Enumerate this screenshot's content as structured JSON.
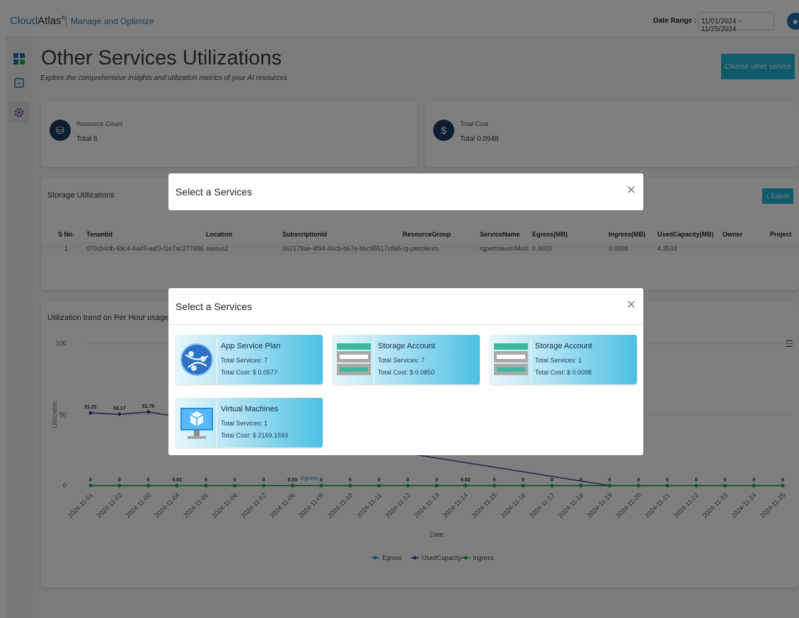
{
  "app": {
    "brand_name": "Cloud",
    "brand_name_2": "Atlas",
    "brand_reg": "®",
    "brand_sub": "Manage and Optimize",
    "date_range_label": "Date Range :",
    "date_range_value": "11/01/2024 - 11/25/2024"
  },
  "page": {
    "title": "Other Services Utilizations",
    "subtitle": "Explore the comprehensive insights and utilization metrics of your AI resources",
    "choose_button": "Choose other service"
  },
  "kpis": [
    {
      "label": "Resource Count",
      "value": "Total 8"
    },
    {
      "label": "Total Cost",
      "value": "Total 0.0948"
    }
  ],
  "storage": {
    "title": "Storage Utilizations",
    "export_label": "Export",
    "columns": [
      "S No.",
      "Tenantid",
      "Location",
      "SubscriptionId",
      "ResourceGroup",
      "ServiceName",
      "Egress(MB)",
      "Ingress(MB)",
      "UsedCapacity(MB)",
      "Owner",
      "Project"
    ],
    "rows": [
      [
        "1",
        "d70cb4db-69c4-4a49-aaf3-f1e7ac277686",
        "eastus2",
        "062179ae-4f94-40cb-b67e-bbc95517c8a5",
        "rg-petroleum",
        "rgpetroleum94dd",
        "0.0003",
        "0.0008",
        "4.3533",
        "",
        ""
      ]
    ]
  },
  "chart_section": {
    "title": "Utilization trend on Per Hour usage of la"
  },
  "chart_data": {
    "type": "line",
    "title": "",
    "xlabel": "Date",
    "ylabel": "Utilization",
    "ylim": [
      0,
      100
    ],
    "yticks": [
      "0",
      "50",
      "100"
    ],
    "categories": [
      "2024-11-01",
      "2024-11-02",
      "2024-11-03",
      "2024-11-04",
      "2024-11-05",
      "2024-11-06",
      "2024-11-07",
      "2024-11-08",
      "2024-11-09",
      "2024-11-10",
      "2024-11-11",
      "2024-11-12",
      "2024-11-13",
      "2024-11-14",
      "2024-11-15",
      "2024-11-16",
      "2024-11-17",
      "2024-11-18",
      "2024-11-19",
      "2024-11-20",
      "2024-11-21",
      "2024-11-22",
      "2024-11-23",
      "2024-11-24",
      "2024-11-25"
    ],
    "series": [
      {
        "name": "Egress",
        "color": "#4a8fd4",
        "values": [
          0,
          0,
          0,
          0.01,
          0,
          0,
          0,
          0.03,
          0,
          0,
          0,
          0,
          0,
          0.02,
          0,
          0,
          0,
          0,
          0,
          0,
          0,
          0,
          0,
          0,
          0
        ]
      },
      {
        "name": "UsedCapacity",
        "color": "#4b3f9e",
        "values": [
          51.21,
          50.17,
          51.79,
          null,
          null,
          null,
          null,
          null,
          null,
          null,
          null,
          null,
          null,
          null,
          null,
          null,
          null,
          null,
          0,
          null,
          null,
          null,
          null,
          null,
          null
        ]
      },
      {
        "name": "Ingress",
        "color": "#27a845",
        "values": [
          0,
          0,
          0,
          0,
          0,
          0,
          0,
          0,
          0,
          0,
          0,
          0,
          0,
          0,
          0,
          0,
          0,
          0,
          0,
          0,
          0,
          0,
          0,
          0,
          0
        ]
      }
    ],
    "data_labels": {
      "UsedCapacity": [
        "51.21",
        "50.17",
        "51.79"
      ],
      "Egress": [
        "0",
        "0",
        "0",
        "0.01",
        "0",
        "0",
        "0",
        "0.03",
        "0",
        "0",
        "0",
        "0",
        "0",
        "0.02",
        "0",
        "0",
        "0",
        "0",
        "0",
        "0",
        "0",
        "0",
        "0",
        "0",
        "0"
      ]
    },
    "tooltip_label": "Egress",
    "legend": [
      "Egress",
      "UsedCapacity",
      "Ingress"
    ],
    "legend_position": "bottom-center"
  },
  "modal_back": {
    "title": "Select a Services"
  },
  "modal_front": {
    "title": "Select a Services",
    "services": [
      {
        "name": "App Service Plan",
        "count": "Total Services: 7",
        "cost": "Total Cost: $ 0.0577",
        "icon": "app-service-plan-icon"
      },
      {
        "name": "Storage Account",
        "count": "Total Services: 7",
        "cost": "Total Cost: $ 0.0850",
        "icon": "storage-account-icon"
      },
      {
        "name": "Storage Account",
        "count": "Total Services: 1",
        "cost": "Total Cost: $ 0.0098",
        "icon": "storage-account-icon"
      },
      {
        "name": "Virtual Machines",
        "count": "Total Services: 1",
        "cost": "Total Cost: $ 2169.1593",
        "icon": "virtual-machine-icon"
      }
    ]
  },
  "colors": {
    "accent": "#1fb4d7",
    "brand_blue": "#2b7bb9",
    "kpi_icon": "#1f3864"
  }
}
